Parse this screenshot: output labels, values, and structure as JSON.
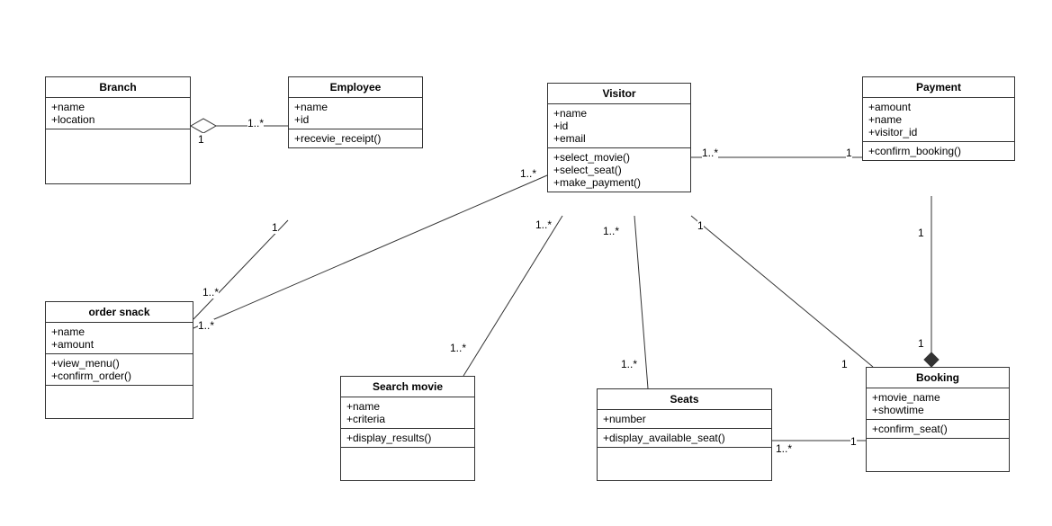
{
  "diagram_type": "UML Class Diagram",
  "classes": {
    "branch": {
      "name": "Branch",
      "attributes": [
        "+name",
        "+location"
      ],
      "operations": []
    },
    "employee": {
      "name": "Employee",
      "attributes": [
        "+name",
        "+id"
      ],
      "operations": [
        "+recevie_receipt()"
      ]
    },
    "visitor": {
      "name": "Visitor",
      "attributes": [
        "+name",
        "+id",
        "+email"
      ],
      "operations": [
        "+select_movie()",
        "+select_seat()",
        "+make_payment()"
      ]
    },
    "payment": {
      "name": "Payment",
      "attributes": [
        "+amount",
        "+name",
        "+visitor_id"
      ],
      "operations": [
        "+confirm_booking()"
      ]
    },
    "order_snack": {
      "name": "order snack",
      "attributes": [
        "+name",
        "+amount"
      ],
      "operations": [
        "+view_menu()",
        "+confirm_order()"
      ]
    },
    "search_movie": {
      "name": "Search movie",
      "attributes": [
        "+name",
        "+criteria"
      ],
      "operations": [
        "+display_results()"
      ]
    },
    "seats": {
      "name": "Seats",
      "attributes": [
        "+number"
      ],
      "operations": [
        "+display_available_seat()"
      ]
    },
    "booking": {
      "name": "Booking",
      "attributes": [
        "+movie_name",
        "+showtime"
      ],
      "operations": [
        "+confirm_seat()"
      ]
    }
  },
  "associations": [
    {
      "from": "Branch",
      "to": "Employee",
      "from_mult": "1",
      "to_mult": "1..*",
      "type": "aggregation"
    },
    {
      "from": "Employee",
      "to": "order snack",
      "from_mult": "1",
      "to_mult": "1..*",
      "type": "association"
    },
    {
      "from": "Visitor",
      "to": "order snack",
      "from_mult": "1..*",
      "to_mult": "1..*",
      "type": "association"
    },
    {
      "from": "Visitor",
      "to": "Payment",
      "from_mult": "1..*",
      "to_mult": "1",
      "type": "association"
    },
    {
      "from": "Visitor",
      "to": "Search movie",
      "from_mult": "1..*",
      "to_mult": "1..*",
      "type": "association"
    },
    {
      "from": "Visitor",
      "to": "Seats",
      "from_mult": "1..*",
      "to_mult": "1..*",
      "type": "association"
    },
    {
      "from": "Visitor",
      "to": "Booking",
      "from_mult": "1",
      "to_mult": "1",
      "type": "association"
    },
    {
      "from": "Seats",
      "to": "Booking",
      "from_mult": "1..*",
      "to_mult": "1",
      "type": "association"
    },
    {
      "from": "Payment",
      "to": "Booking",
      "from_mult": "1",
      "to_mult": "1",
      "type": "composition"
    }
  ],
  "mult": {
    "one": "1",
    "one_many": "1..*"
  }
}
